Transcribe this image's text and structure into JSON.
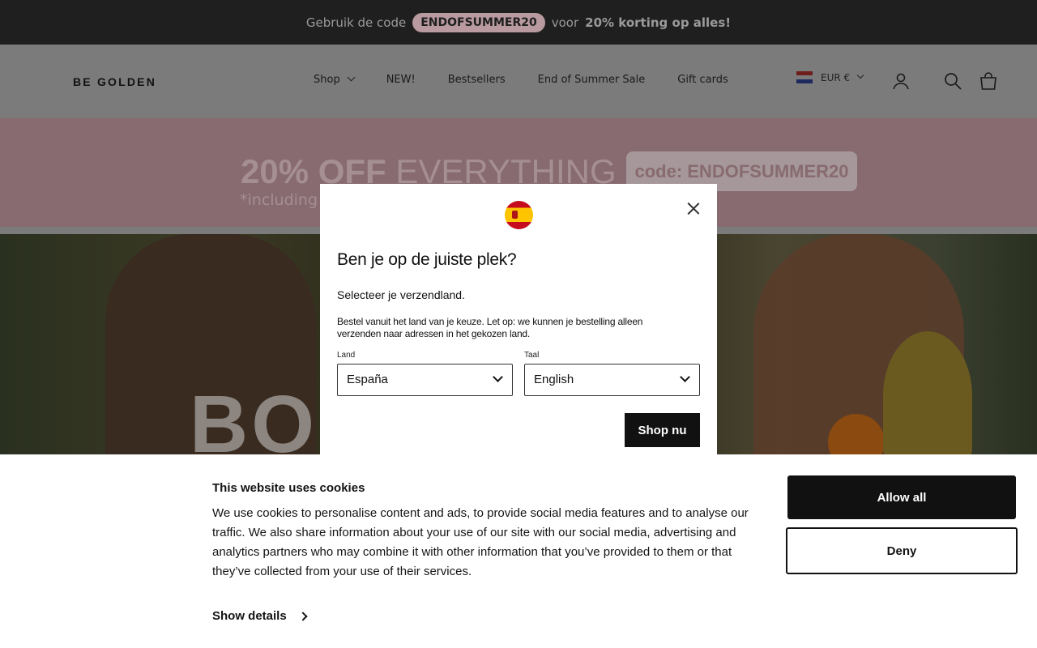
{
  "announcement": {
    "prefix": "Gebruik de code",
    "code": "ENDOFSUMMER20",
    "middle": "voor",
    "highlight": "20% korting op alles!"
  },
  "header": {
    "logo": "BE GOLDEN",
    "nav": [
      "Shop",
      "NEW!",
      "Bestsellers",
      "End of Summer Sale",
      "Gift cards"
    ],
    "currency": "EUR €",
    "icons": [
      "account-icon",
      "search-icon",
      "cart-icon"
    ]
  },
  "banner": {
    "bold": "20% OFF",
    "rest": "EVERYTHING",
    "sub": "*including",
    "code": "code: ENDOFSUMMER20"
  },
  "hero": {
    "partial_text": "BO"
  },
  "modal": {
    "title": "Ben je op de juiste plek?",
    "subtitle": "Selecteer je verzendland.",
    "description": "Bestel vanuit het land van je keuze. Let op: we kunnen je bestelling alleen verzenden naar adressen in het gekozen land.",
    "country_label": "Land",
    "country_value": "España",
    "language_label": "Taal",
    "language_value": "English",
    "submit": "Shop nu"
  },
  "cookie": {
    "title": "This website uses cookies",
    "body": "We use cookies to personalise content and ads, to provide social media features and to analyse our traffic. We also share information about your use of our site with our social media, advertising and analytics partners who may combine it with other information that you’ve provided to them or that they’ve collected from your use of their services.",
    "details": "Show details",
    "allow": "Allow all",
    "deny": "Deny"
  }
}
